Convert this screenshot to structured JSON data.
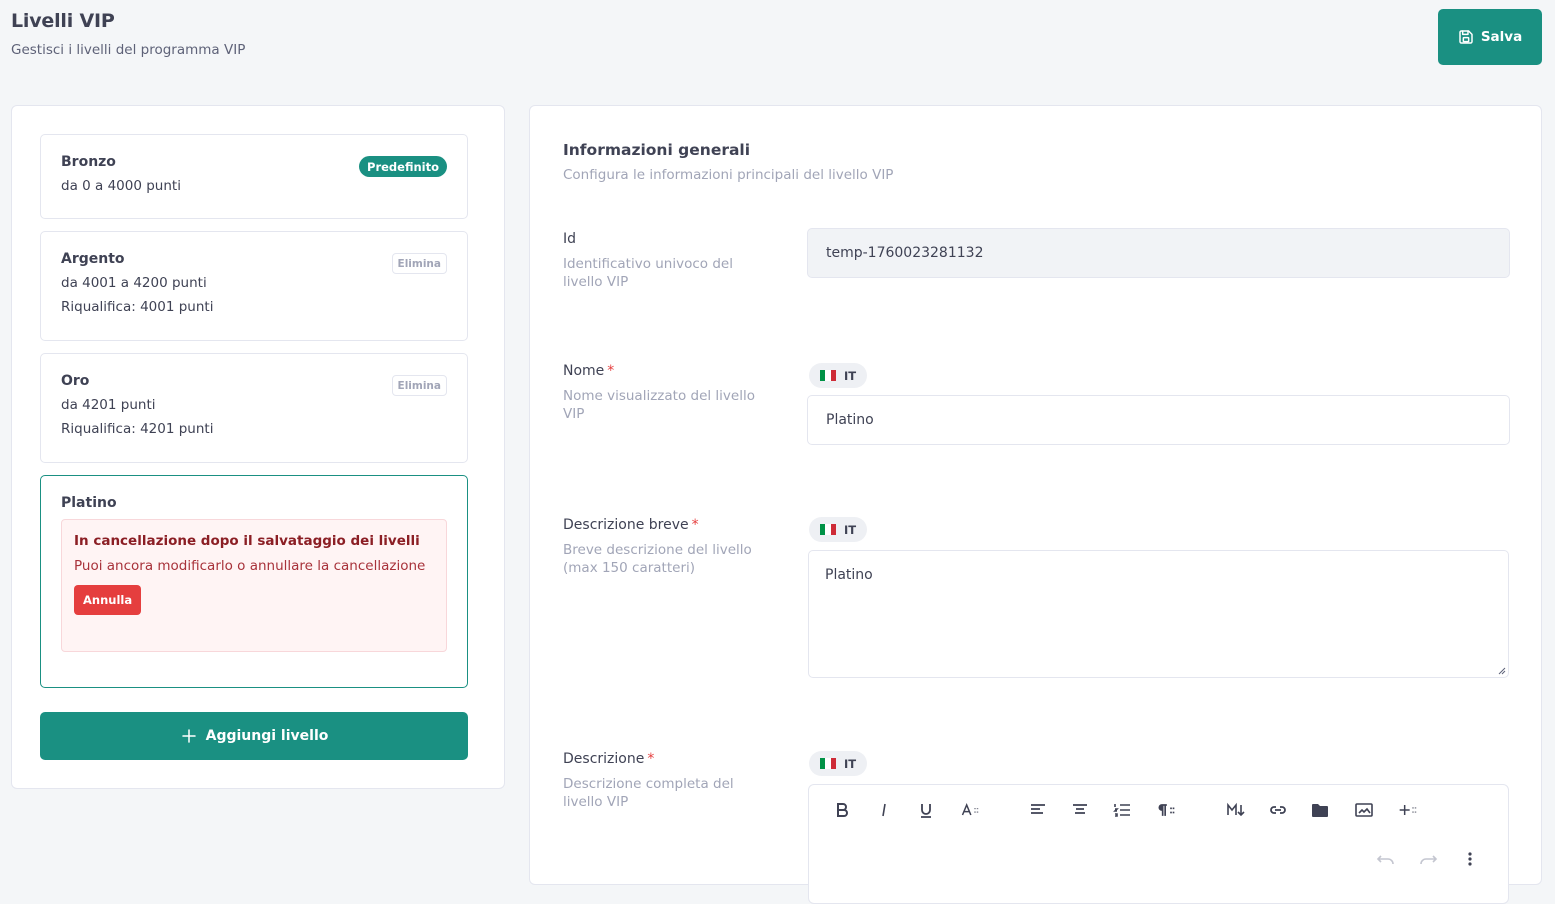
{
  "header": {
    "title": "Livelli VIP",
    "subtitle": "Gestisci i livelli del programma VIP",
    "save_label": "Salva"
  },
  "levels": [
    {
      "name": "Bronzo",
      "lines": [
        "da 0 a 4000 punti"
      ],
      "badge": "Predefinito"
    },
    {
      "name": "Argento",
      "lines": [
        "da 4001 a 4200 punti",
        "Riqualifica: 4001 punti"
      ],
      "action": "Elimina"
    },
    {
      "name": "Oro",
      "lines": [
        "da 4201 punti",
        "Riqualifica: 4201 punti"
      ],
      "action": "Elimina"
    },
    {
      "name": "Platino",
      "alert": {
        "title": "In cancellazione dopo il salvataggio dei livelli",
        "text": "Puoi ancora modificarlo o annullare la cancellazione",
        "button": "Annulla"
      }
    }
  ],
  "add_level_label": "Aggiungi livello",
  "form": {
    "section_title": "Informazioni generali",
    "section_desc": "Configura le informazioni principali del livello VIP",
    "required_mark": "*",
    "lang": "IT",
    "fields": {
      "id": {
        "label": "Id",
        "help": "Identificativo univoco del livello VIP",
        "value": "temp-1760023281132"
      },
      "nome": {
        "label": "Nome",
        "help": "Nome visualizzato del livello VIP",
        "value": "Platino"
      },
      "descrizione_breve": {
        "label": "Descrizione breve",
        "help": "Breve descrizione del livello (max 150 caratteri)",
        "value": "Platino"
      },
      "descrizione": {
        "label": "Descrizione",
        "help": "Descrizione completa del livello VIP"
      }
    }
  },
  "colors": {
    "accent": "#1a9082",
    "danger": "#e53e3e",
    "flag": [
      "#009246",
      "#ffffff",
      "#ce2b37"
    ]
  },
  "editor_toolbar": [
    "bold-icon",
    "italic-icon",
    "underline-icon",
    "font-size-icon",
    "align-left-icon",
    "align-center-icon",
    "ordered-list-icon",
    "paragraph-icon",
    "markdown-icon",
    "link-icon",
    "folder-icon",
    "image-icon",
    "insert-more-icon",
    "undo-icon",
    "redo-icon",
    "more-vertical-icon"
  ]
}
